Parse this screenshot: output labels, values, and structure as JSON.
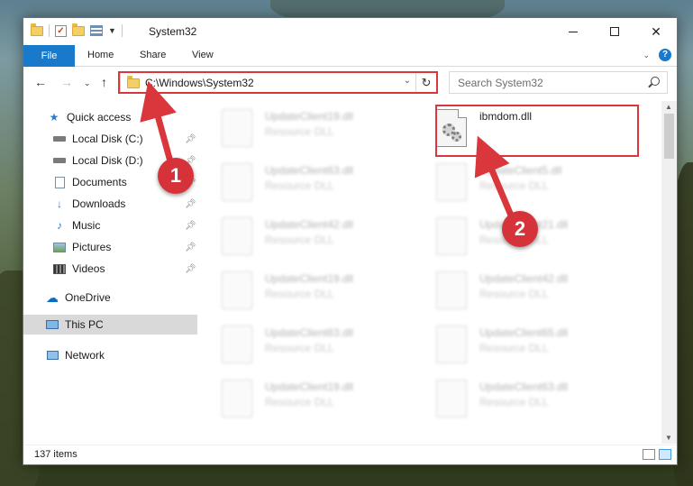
{
  "window": {
    "title": "System32",
    "accent_color": "#1979ca"
  },
  "ribbon": {
    "tabs": [
      "File",
      "Home",
      "Share",
      "View"
    ]
  },
  "navigation": {
    "address": "C:\\Windows\\System32",
    "search_placeholder": "Search System32"
  },
  "sidebar": {
    "items": [
      {
        "label": "Quick access",
        "icon": "star-icon",
        "pinned": false
      },
      {
        "label": "Local Disk (C:)",
        "icon": "drive-icon",
        "pinned": true
      },
      {
        "label": "Local Disk (D:)",
        "icon": "drive-icon",
        "pinned": true
      },
      {
        "label": "Documents",
        "icon": "documents-icon",
        "pinned": true
      },
      {
        "label": "Downloads",
        "icon": "download-icon",
        "pinned": true
      },
      {
        "label": "Music",
        "icon": "music-icon",
        "pinned": true
      },
      {
        "label": "Pictures",
        "icon": "pictures-icon",
        "pinned": true
      },
      {
        "label": "Videos",
        "icon": "videos-icon",
        "pinned": true
      },
      {
        "label": "OneDrive",
        "icon": "cloud-icon",
        "pinned": false
      },
      {
        "label": "This PC",
        "icon": "computer-icon",
        "pinned": false,
        "selected": true
      },
      {
        "label": "Network",
        "icon": "network-icon",
        "pinned": false
      }
    ]
  },
  "files": {
    "highlighted": {
      "name": "ibmdom.dll"
    },
    "left_column": [
      {
        "name": "UpdateClient19.dll",
        "type": "Resource DLL"
      },
      {
        "name": "UpdateClient63.dll",
        "type": "Resource DLL"
      },
      {
        "name": "UpdateClient42.dll",
        "type": "Resource DLL"
      },
      {
        "name": "UpdateClient19.dll",
        "type": "Resource DLL"
      },
      {
        "name": "UpdateClient63.dll",
        "type": "Resource DLL"
      },
      {
        "name": "UpdateClient19.dll",
        "type": "Resource DLL"
      }
    ],
    "right_column": [
      {
        "name": "UpdateClient5.dll",
        "type": "Resource DLL"
      },
      {
        "name": "UpdateClient21.dll",
        "type": "Resource DLL"
      },
      {
        "name": "UpdateClient42.dll",
        "type": "Resource DLL"
      },
      {
        "name": "UpdateClient65.dll",
        "type": "Resource DLL"
      },
      {
        "name": "UpdateClient63.dll",
        "type": "Resource DLL"
      }
    ]
  },
  "status": {
    "item_count": "137 items"
  },
  "annotations": {
    "step1": "1",
    "step2": "2",
    "color": "#d9373b"
  }
}
